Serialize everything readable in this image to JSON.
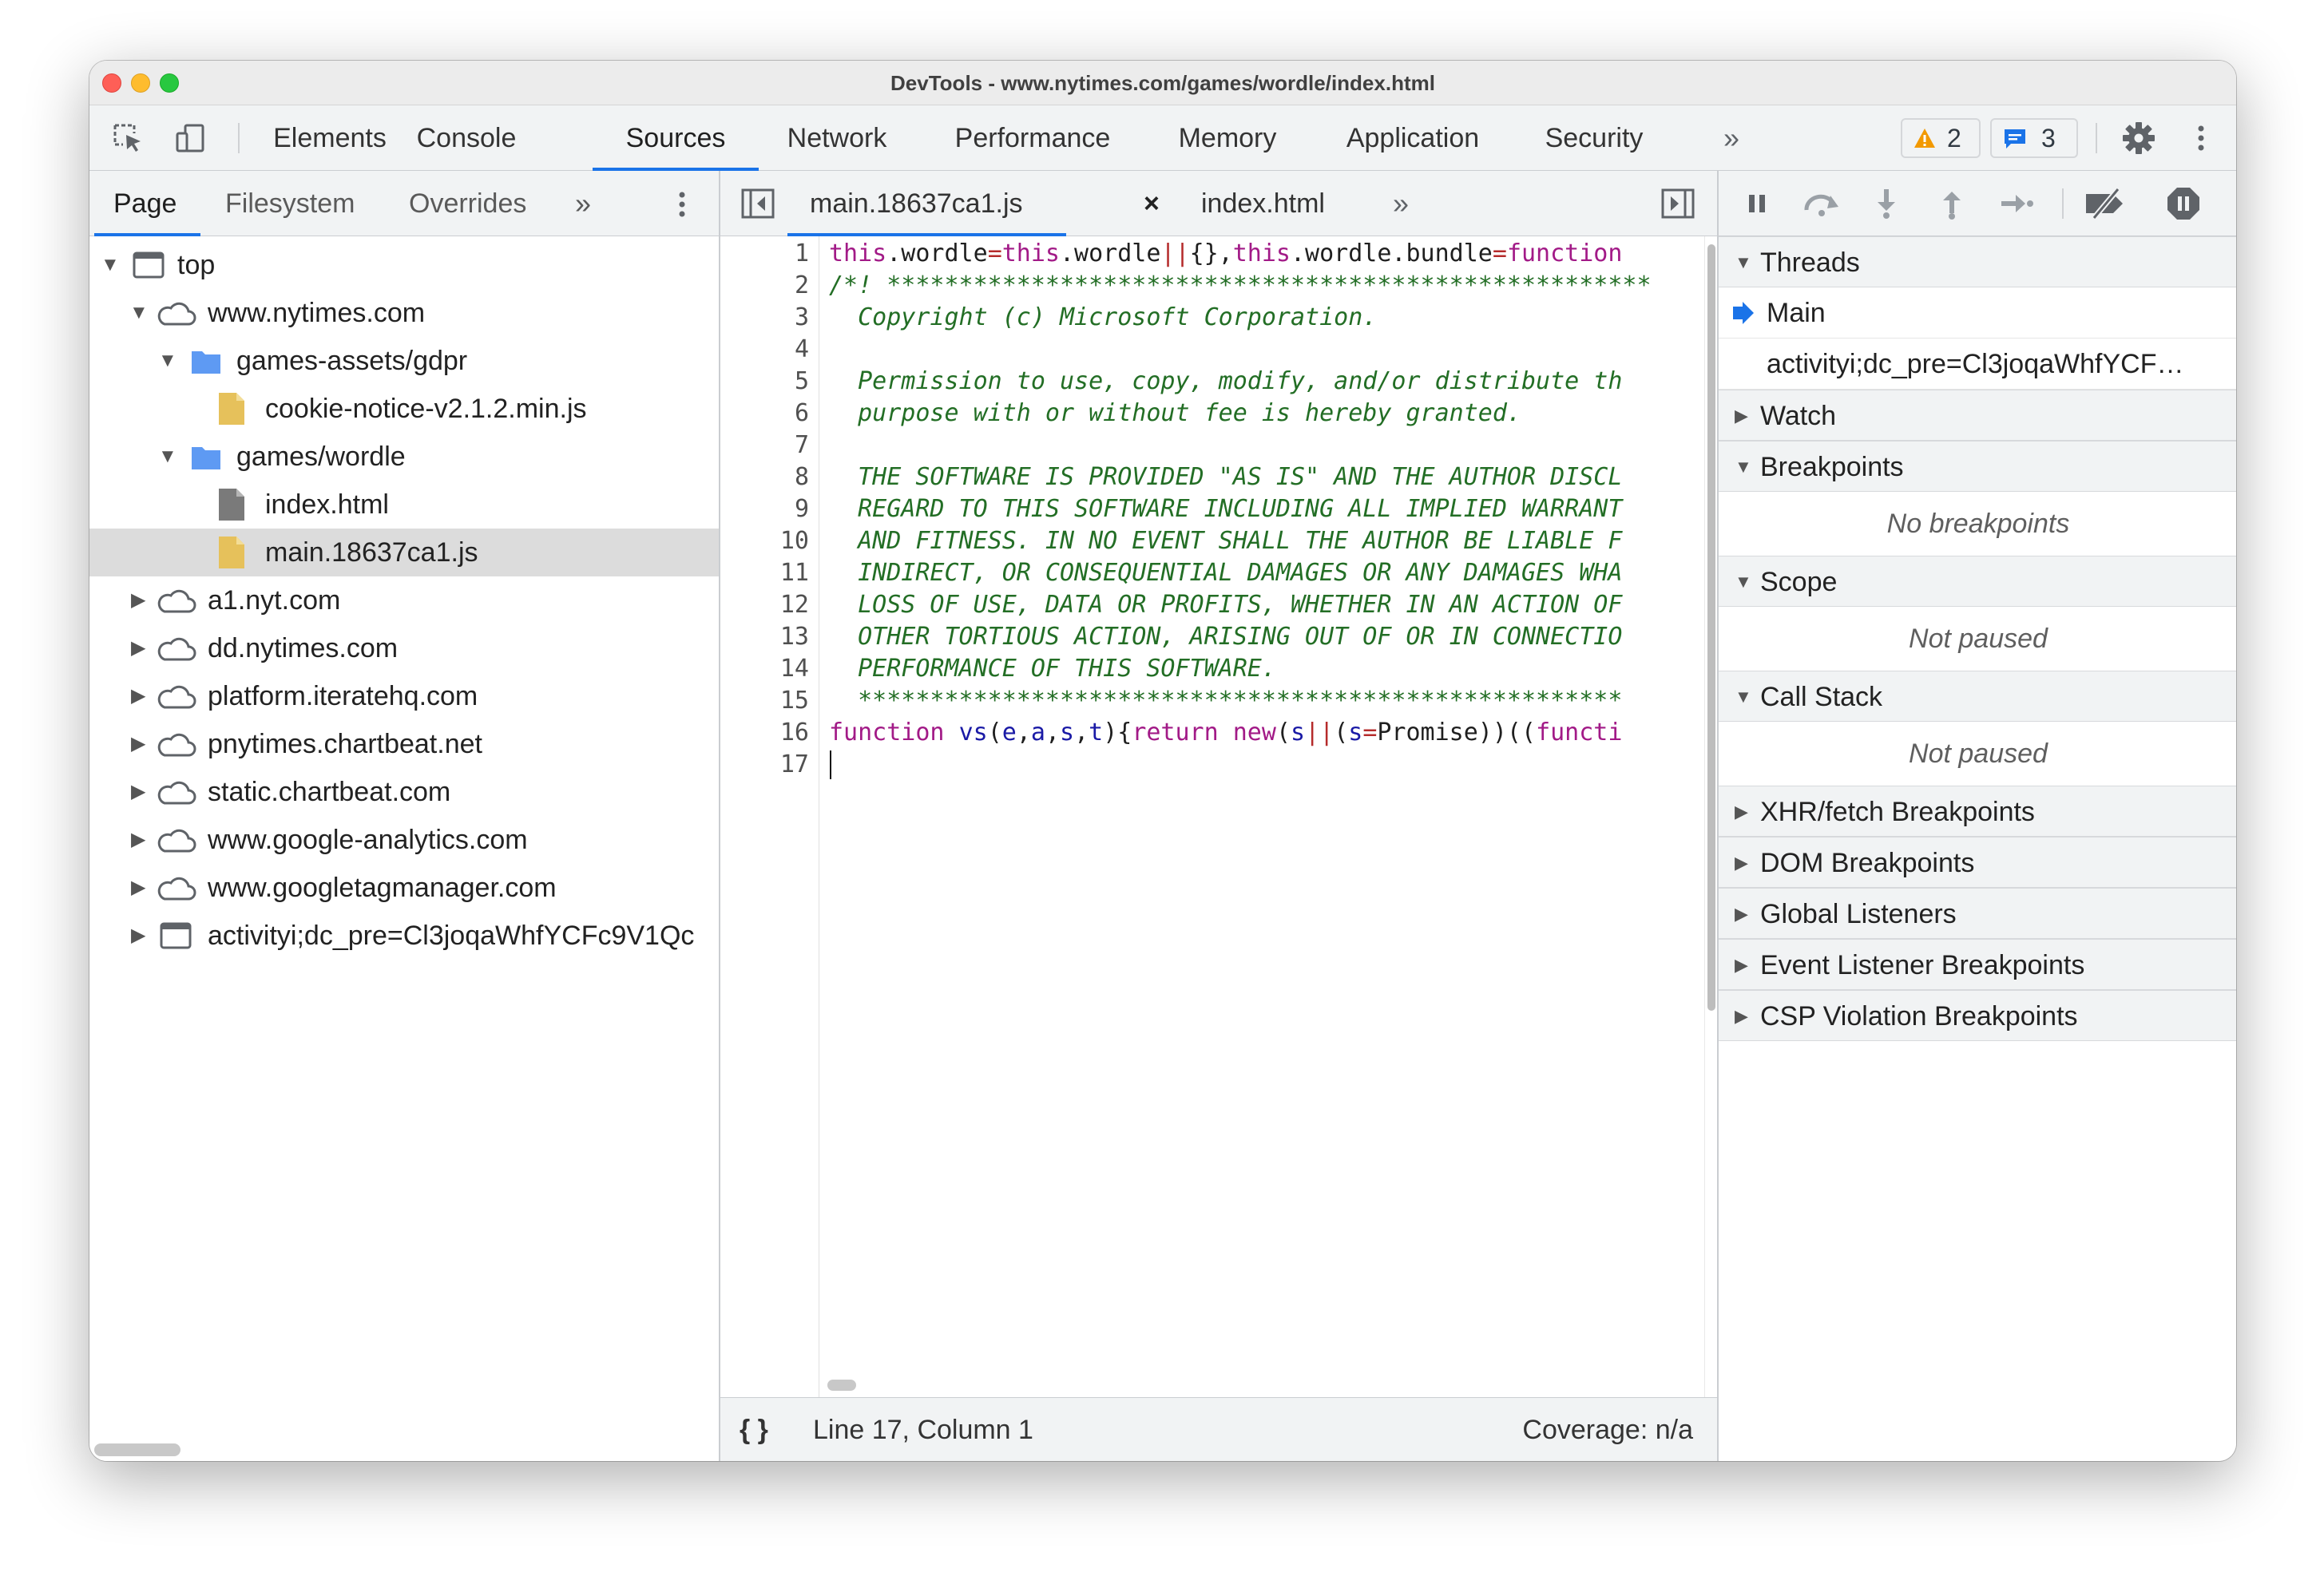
{
  "window": {
    "title": "DevTools - www.nytimes.com/games/wordle/index.html"
  },
  "main_tabs": [
    "Elements",
    "Console",
    "Sources",
    "Network",
    "Performance",
    "Memory",
    "Application",
    "Security"
  ],
  "active_main_tab": "Sources",
  "toolbar": {
    "more_tabs": "»",
    "warnings_count": "2",
    "messages_count": "3"
  },
  "navigator": {
    "tabs": [
      "Page",
      "Filesystem",
      "Overrides"
    ],
    "active_tab": "Page",
    "more": "»",
    "tree": [
      {
        "label": "top",
        "icon": "frame-icon",
        "expanded": true
      },
      {
        "label": "www.nytimes.com",
        "icon": "cloud-icon",
        "expanded": true
      },
      {
        "label": "games-assets/gdpr",
        "icon": "folder-icon",
        "expanded": true
      },
      {
        "label": "cookie-notice-v2.1.2.min.js",
        "icon": "js-file-icon"
      },
      {
        "label": "games/wordle",
        "icon": "folder-icon",
        "expanded": true
      },
      {
        "label": "index.html",
        "icon": "html-file-icon"
      },
      {
        "label": "main.18637ca1.js",
        "icon": "js-file-icon",
        "selected": true
      },
      {
        "label": "a1.nyt.com",
        "icon": "cloud-icon",
        "expanded": false
      },
      {
        "label": "dd.nytimes.com",
        "icon": "cloud-icon",
        "expanded": false
      },
      {
        "label": "platform.iteratehq.com",
        "icon": "cloud-icon",
        "expanded": false
      },
      {
        "label": "pnytimes.chartbeat.net",
        "icon": "cloud-icon",
        "expanded": false
      },
      {
        "label": "static.chartbeat.com",
        "icon": "cloud-icon",
        "expanded": false
      },
      {
        "label": "www.google-analytics.com",
        "icon": "cloud-icon",
        "expanded": false
      },
      {
        "label": "www.googletagmanager.com",
        "icon": "cloud-icon",
        "expanded": false
      },
      {
        "label": "activityi;dc_pre=Cl3joqaWhfYCFc9V1Qc",
        "icon": "frame-icon",
        "expanded": false
      }
    ]
  },
  "editor": {
    "tabs": [
      {
        "label": "main.18637ca1.js",
        "active": true,
        "close": "×"
      },
      {
        "label": "index.html",
        "active": false
      }
    ],
    "more": "»",
    "line_numbers": [
      "1",
      "2",
      "3",
      "4",
      "5",
      "6",
      "7",
      "8",
      "9",
      "10",
      "11",
      "12",
      "13",
      "14",
      "15",
      "16",
      "17"
    ],
    "status": {
      "pretty_print": "{ }",
      "position": "Line 17, Column 1",
      "coverage": "Coverage: n/a"
    }
  },
  "debugger": {
    "threads": {
      "label": "Threads",
      "items": [
        "Main",
        "activityi;dc_pre=Cl3joqaWhfYCF…"
      ]
    },
    "watch": "Watch",
    "breakpoints": {
      "label": "Breakpoints",
      "empty": "No breakpoints"
    },
    "scope": {
      "label": "Scope",
      "empty": "Not paused"
    },
    "call_stack": {
      "label": "Call Stack",
      "empty": "Not paused"
    },
    "more_sections": [
      "XHR/fetch Breakpoints",
      "DOM Breakpoints",
      "Global Listeners",
      "Event Listener Breakpoints",
      "CSP Violation Breakpoints"
    ]
  },
  "colors": {
    "accent": "#1a73e8",
    "warning": "#f29900",
    "comment": "#236e25",
    "keyword": "#a21a87"
  }
}
